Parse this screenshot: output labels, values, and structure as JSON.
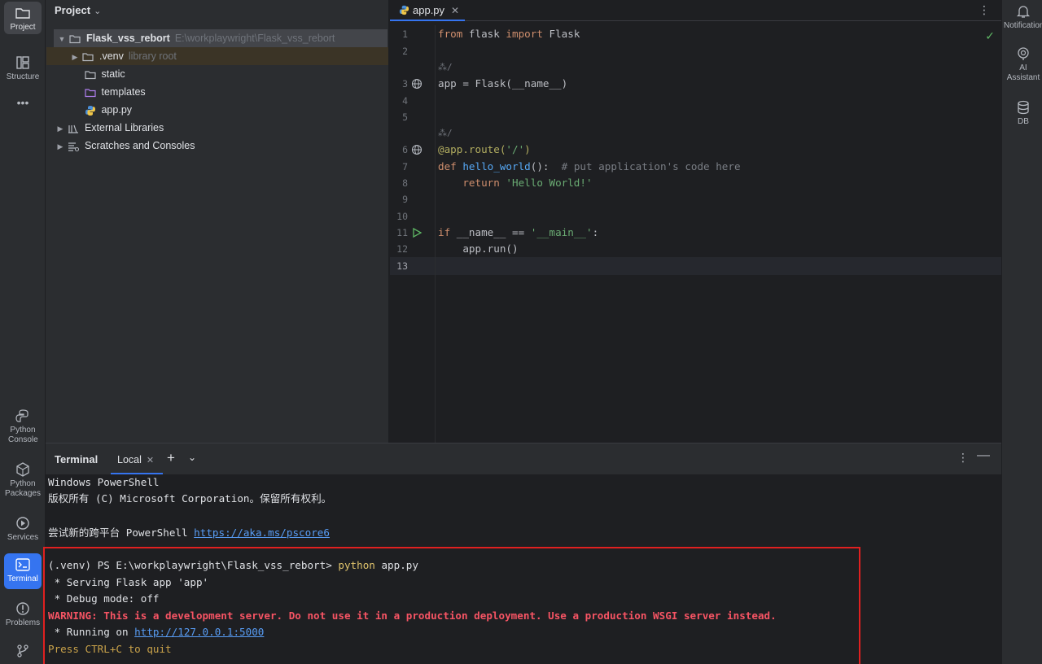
{
  "left_strip": {
    "top": [
      {
        "name": "project",
        "label": "Project",
        "icon": "folder-icon"
      },
      {
        "name": "structure",
        "label": "Structure",
        "icon": "structure-icon"
      },
      {
        "name": "more",
        "label": "•••",
        "icon": "more-icon"
      }
    ],
    "bottom": [
      {
        "name": "python-console",
        "label": "Python Console",
        "icon": "python-console-icon"
      },
      {
        "name": "python-packages",
        "label": "Python Packages",
        "icon": "packages-icon"
      },
      {
        "name": "services",
        "label": "Services",
        "icon": "services-icon"
      },
      {
        "name": "terminal",
        "label": "Terminal",
        "icon": "terminal-icon"
      },
      {
        "name": "problems",
        "label": "Problems",
        "icon": "problems-icon"
      },
      {
        "name": "git",
        "label": "",
        "icon": "git-icon"
      }
    ]
  },
  "right_strip": {
    "items": [
      {
        "name": "notifications",
        "label": "Notifications",
        "icon": "bell-icon"
      },
      {
        "name": "ai-assistant",
        "label_line1": "AI",
        "label_line2": "Assistant",
        "icon": "ai-icon"
      },
      {
        "name": "db",
        "label": "DB",
        "icon": "database-icon"
      }
    ]
  },
  "project_panel": {
    "title": "Project",
    "tree": {
      "root_name": "Flask_vss_rebort",
      "root_path": "E:\\workplaywright\\Flask_vss_rebort",
      "venv_name": ".venv",
      "venv_hint": "library root",
      "static": "static",
      "templates": "templates",
      "app_py": "app.py",
      "external": "External Libraries",
      "scratches": "Scratches and Consoles"
    }
  },
  "editor": {
    "tab_label": "app.py",
    "line_numbers": [
      "1",
      "2",
      "3",
      "4",
      "5",
      "6",
      "7",
      "8",
      "9",
      "10",
      "11",
      "12",
      "13"
    ],
    "hint": "⁂/",
    "code": {
      "l1_kw1": "from",
      "l1_mod": " flask ",
      "l1_kw2": "import",
      "l1_name": " Flask",
      "l3": "app = Flask(__name__)",
      "l6_dec": "@app.route(",
      "l6_str": "'/'",
      "l6_close": ")",
      "l7_kw": "def ",
      "l7_fn": "hello_world",
      "l7_rest": "():  ",
      "l7_cmt": "# put application's code here",
      "l8_kw": "    return ",
      "l8_str": "'Hello World!'",
      "l11_kw": "if ",
      "l11_mid": "__name__ == ",
      "l11_str": "'__main__'",
      "l11_end": ":",
      "l12": "    app.run()"
    }
  },
  "terminal": {
    "title": "Terminal",
    "tab_label": "Local",
    "lines": {
      "l1": "Windows PowerShell",
      "l2": "版权所有 (C) Microsoft Corporation。保留所有权利。",
      "l4_text": "尝试新的跨平台 PowerShell ",
      "l4_link": "https://aka.ms/pscore6",
      "l6_prompt": "(.venv) PS E:\\workplaywright\\Flask_vss_rebort> ",
      "l6_cmd": "python",
      "l6_arg": " app.py",
      "l7": " * Serving Flask app 'app'",
      "l8": " * Debug mode: off",
      "l9": "WARNING: This is a development server. Do not use it in a production deployment. Use a production WSGI server instead.",
      "l10_text": " * Running on ",
      "l10_link": "http://127.0.0.1:5000",
      "l11": "Press CTRL+C to quit"
    }
  },
  "colors": {
    "accent": "#3574f0",
    "highlight_box": "#e02020",
    "warning": "#f75464"
  }
}
